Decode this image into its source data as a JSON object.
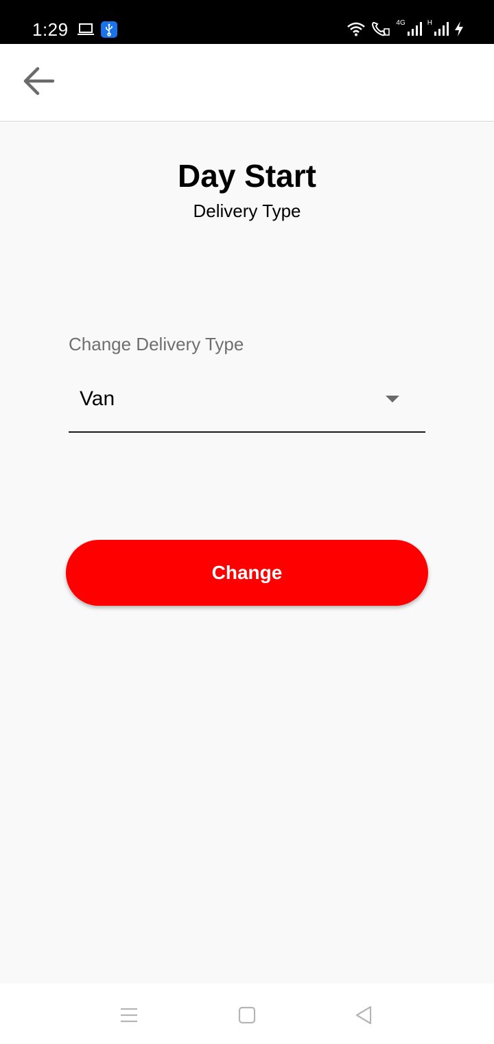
{
  "status_bar": {
    "time": "1:29",
    "network_label_1": "4G",
    "network_label_2": "H",
    "icons": [
      "laptop-icon",
      "usb-icon",
      "wifi-icon",
      "call-icon",
      "signal-icon",
      "signal-icon",
      "charging-icon"
    ],
    "usb_icon_color": "#1a73e8"
  },
  "app_bar": {
    "back_icon": "arrow-left-icon"
  },
  "header": {
    "title": "Day Start",
    "subtitle": "Delivery Type"
  },
  "form": {
    "label": "Change Delivery Type",
    "selected_value": "Van",
    "dropdown_icon": "caret-down-icon"
  },
  "actions": {
    "change_label": "Change",
    "change_color": "#ff0000"
  },
  "nav_bar": {
    "icons": [
      "menu-icon",
      "home-icon",
      "back-triangle-icon"
    ]
  }
}
